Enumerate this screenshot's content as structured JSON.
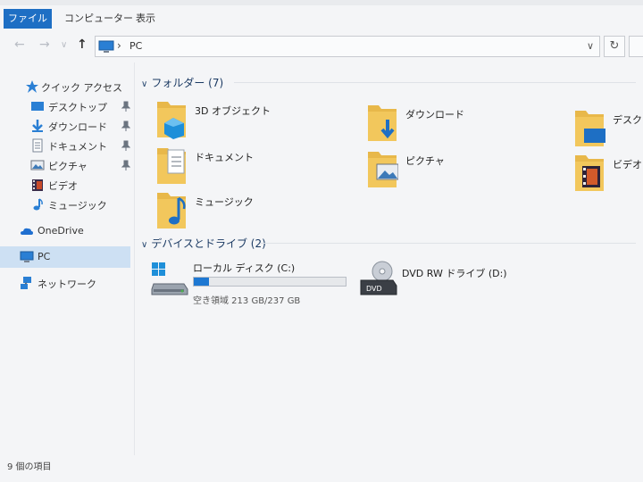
{
  "ribbon": {
    "tabs": [
      "ファイル",
      "コンピューター",
      "表示"
    ]
  },
  "address": {
    "path": "PC"
  },
  "sidebar": {
    "items": [
      {
        "label": "クイック アクセス",
        "icon": "star-icon"
      },
      {
        "label": "デスクトップ",
        "icon": "desktop-icon",
        "pinned": true
      },
      {
        "label": "ダウンロード",
        "icon": "download-icon",
        "pinned": true
      },
      {
        "label": "ドキュメント",
        "icon": "document-icon",
        "pinned": true
      },
      {
        "label": "ピクチャ",
        "icon": "picture-icon",
        "pinned": true
      },
      {
        "label": "ビデオ",
        "icon": "video-icon"
      },
      {
        "label": "ミュージック",
        "icon": "music-icon"
      },
      {
        "label": "OneDrive",
        "icon": "cloud-icon"
      },
      {
        "label": "PC",
        "icon": "pc-icon",
        "selected": true
      },
      {
        "label": "ネットワーク",
        "icon": "network-icon"
      }
    ]
  },
  "main": {
    "folders_header": "フォルダー (7)",
    "folders": [
      {
        "label": "3D オブジェクト",
        "icon": "3d-objects-icon"
      },
      {
        "label": "ダウンロード",
        "icon": "downloads-folder-icon"
      },
      {
        "label": "デスクトップ",
        "icon": "desktop-folder-icon"
      },
      {
        "label": "ドキュメント",
        "icon": "documents-folder-icon"
      },
      {
        "label": "ピクチャ",
        "icon": "pictures-folder-icon"
      },
      {
        "label": "ビデオ",
        "icon": "videos-folder-icon"
      },
      {
        "label": "ミュージック",
        "icon": "music-folder-icon"
      }
    ],
    "drives_header": "デバイスとドライブ (2)",
    "drives": [
      {
        "label": "ローカル ディスク (C:)",
        "free_text": "空き領域 213 GB/237 GB",
        "used_fraction": 0.1,
        "icon": "local-disk-icon"
      },
      {
        "label": "DVD RW ドライブ (D:)",
        "icon": "dvd-drive-icon"
      }
    ]
  },
  "status": {
    "text": "9 個の項目"
  },
  "colors": {
    "accent": "#1e6fc4",
    "folder": "#e8b84a",
    "selection": "#cde0f3",
    "drive_bar": "#1e78d2"
  }
}
